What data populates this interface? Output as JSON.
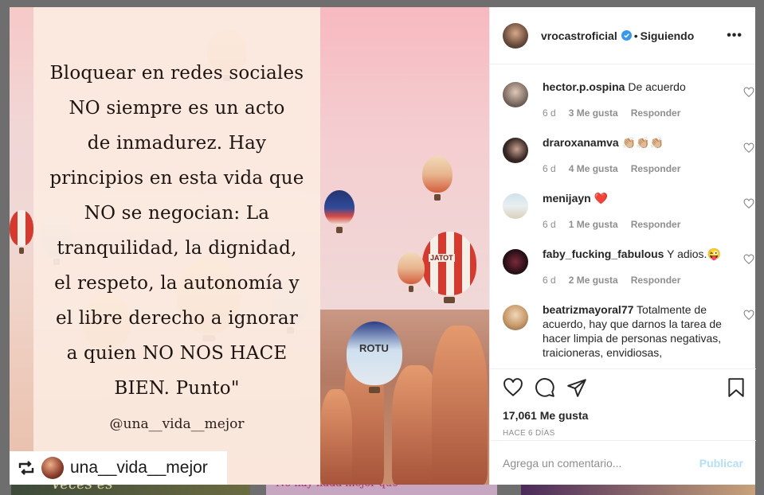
{
  "post": {
    "quote_lines": [
      "Bloquear en redes sociales",
      "NO siempre es un acto",
      "de inmadurez. Hay",
      "principios en esta vida que",
      "NO se negocian: La",
      "tranquilidad, la dignidad,",
      "el respeto, la autonomía y",
      "el libre derecho a ignorar",
      "a quien NO NOS HACE",
      "BIEN. Punto\""
    ],
    "quote_handle": "@una__vida__mejor",
    "balloon_labels": [
      "JATOT",
      "ROTU"
    ],
    "repost_username": "una__vida__mejor"
  },
  "background_tiles": {
    "left_text": "Veces es",
    "middle_text": "No hay nada mejor que"
  },
  "header": {
    "username": "vrocastroficial",
    "dot": "•",
    "follow_label": "Siguiendo",
    "more_label": "•••"
  },
  "comments": [
    {
      "user": "hector.p.ospina",
      "text": "De acuerdo",
      "time": "6 d",
      "likes": "3 Me gusta",
      "reply": "Responder"
    },
    {
      "user": "draroxanamva",
      "text": "👏🏼👏🏼👏🏼",
      "time": "6 d",
      "likes": "4 Me gusta",
      "reply": "Responder"
    },
    {
      "user": "menijayn",
      "text": "❤️",
      "time": "6 d",
      "likes": "1 Me gusta",
      "reply": "Responder"
    },
    {
      "user": "faby_fucking_fabulous",
      "text": "Y adios.😜",
      "time": "6 d",
      "likes": "2 Me gusta",
      "reply": "Responder"
    },
    {
      "user": "beatrizmayoral77",
      "text": "Totalmente de acuerdo, hay que darnos la tarea de hacer limpia de personas negativas, traicioneras, envidiosas,",
      "time": "",
      "likes": "",
      "reply": ""
    }
  ],
  "actions": {
    "likes_count": "17,061 Me gusta",
    "time_ago": "HACE 6 DÍAS"
  },
  "add_comment": {
    "placeholder": "Agrega un comentario...",
    "publish_label": "Publicar"
  },
  "colors": {
    "verified_badge": "#3897f0",
    "publish_disabled": "#b2dffc",
    "meta_gray": "#8e8e8e"
  }
}
